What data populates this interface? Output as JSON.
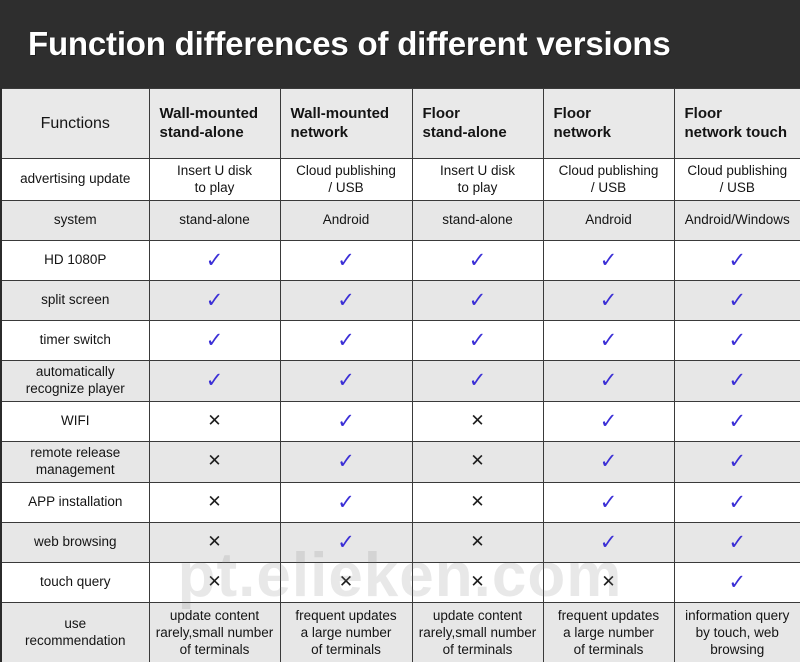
{
  "banner": {
    "title": "Function differences of different versions",
    "background_color": "#2e2e2e",
    "text_color": "#ffffff"
  },
  "watermark": {
    "text": "pt.elieken.com"
  },
  "colors": {
    "check_mark": "#3b2fd6",
    "cross_mark": "#1d1d1d",
    "header_row": "#e9e9e9",
    "row_even": "#e7e7e7",
    "row_odd": "#ffffff",
    "border": "#3a3a3a"
  },
  "icons": {
    "check": "✓",
    "cross": "✕"
  },
  "table": {
    "columns": [
      {
        "label": "Functions"
      },
      {
        "label": "Wall-mounted stand-alone"
      },
      {
        "label": "Wall-mounted network"
      },
      {
        "label": "Floor stand-alone"
      },
      {
        "label": "Floor network"
      },
      {
        "label": "Floor network touch"
      }
    ],
    "column_lines": [
      [
        "Functions"
      ],
      [
        "Wall-mounted",
        "stand-alone"
      ],
      [
        "Wall-mounted",
        "network"
      ],
      [
        "Floor",
        "stand-alone"
      ],
      [
        "Floor",
        "network"
      ],
      [
        "Floor",
        "network touch"
      ]
    ],
    "rows": [
      {
        "label": "advertising update",
        "type": "text",
        "cells": [
          [
            "Insert U disk",
            "to play"
          ],
          [
            "Cloud publishing",
            "/ USB"
          ],
          [
            "Insert U disk",
            "to play"
          ],
          [
            "Cloud publishing",
            "/ USB"
          ],
          [
            "Cloud publishing",
            "/ USB"
          ]
        ]
      },
      {
        "label": "system",
        "type": "center-text",
        "cells": [
          "stand-alone",
          "Android",
          "stand-alone",
          "Android",
          "Android/Windows"
        ]
      },
      {
        "label": "HD 1080P",
        "type": "mark",
        "cells": [
          "check",
          "check",
          "check",
          "check",
          "check"
        ]
      },
      {
        "label": "split screen",
        "type": "mark",
        "cells": [
          "check",
          "check",
          "check",
          "check",
          "check"
        ]
      },
      {
        "label": "timer switch",
        "type": "mark",
        "cells": [
          "check",
          "check",
          "check",
          "check",
          "check"
        ]
      },
      {
        "label_lines": [
          "automatically",
          "recognize player"
        ],
        "label": "automatically recognize player",
        "type": "mark",
        "cells": [
          "check",
          "check",
          "check",
          "check",
          "check"
        ]
      },
      {
        "label": "WIFI",
        "type": "mark",
        "cells": [
          "cross",
          "check",
          "cross",
          "check",
          "check"
        ]
      },
      {
        "label_lines": [
          "remote release",
          "management"
        ],
        "label": "remote release management",
        "type": "mark",
        "cells": [
          "cross",
          "check",
          "cross",
          "check",
          "check"
        ]
      },
      {
        "label": "APP installation",
        "type": "mark",
        "cells": [
          "cross",
          "check",
          "cross",
          "check",
          "check"
        ]
      },
      {
        "label": "web browsing",
        "type": "mark",
        "cells": [
          "cross",
          "check",
          "cross",
          "check",
          "check"
        ]
      },
      {
        "label": "touch query",
        "type": "mark",
        "cells": [
          "cross",
          "cross",
          "cross",
          "cross",
          "check"
        ]
      },
      {
        "label_lines": [
          "use",
          "recommendation"
        ],
        "label": "use recommendation",
        "type": "use",
        "cells": [
          [
            "update content",
            "rarely,small number",
            "of terminals"
          ],
          [
            "frequent updates",
            "a large number",
            "of terminals"
          ],
          [
            "update content",
            "rarely,small number",
            "of terminals"
          ],
          [
            "frequent updates",
            "a large number",
            "of terminals"
          ],
          [
            "information query",
            "by touch, web",
            "browsing"
          ]
        ]
      }
    ]
  }
}
